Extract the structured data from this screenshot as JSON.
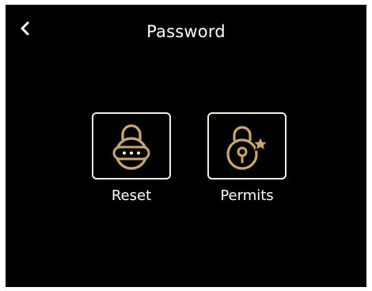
{
  "header": {
    "title": "Password",
    "back_icon": "chevron-left-icon"
  },
  "tiles": [
    {
      "label": "Reset",
      "icon": "lock-password-icon"
    },
    {
      "label": "Permits",
      "icon": "lock-star-icon"
    }
  ],
  "colors": {
    "background": "#000000",
    "text": "#ffffff",
    "icon_accent": "#c9a76e",
    "tile_border": "#f2ece2"
  }
}
